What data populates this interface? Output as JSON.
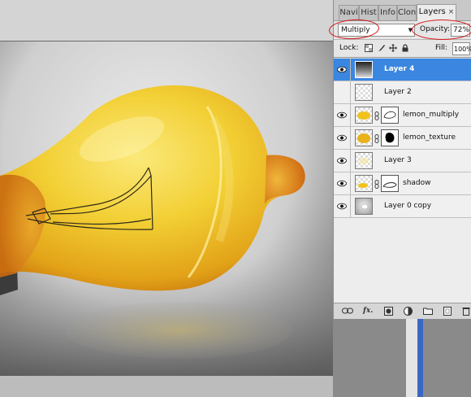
{
  "panel": {
    "tabs": [
      {
        "label": "Navi"
      },
      {
        "label": "Hist"
      },
      {
        "label": "Info"
      },
      {
        "label": "Clon"
      },
      {
        "label": "Layers",
        "active": true,
        "close": "×"
      }
    ],
    "blend_mode": "Multiply",
    "opacity_label": "Opacity:",
    "opacity_value": "72%",
    "lock_label": "Lock:",
    "fill_label": "Fill:",
    "fill_value": "100%",
    "layers": [
      {
        "name": "Layer 4",
        "selected": true,
        "visible": true,
        "thumb": "gradient",
        "mask": null
      },
      {
        "name": "Layer 2",
        "selected": false,
        "visible": false,
        "thumb": "transparent",
        "mask": null
      },
      {
        "name": "lemon_multiply",
        "selected": false,
        "visible": true,
        "thumb": "lemon",
        "mask": "outline"
      },
      {
        "name": "lemon_texture",
        "selected": false,
        "visible": true,
        "thumb": "lemon",
        "mask": "black-shape"
      },
      {
        "name": "Layer 3",
        "selected": false,
        "visible": true,
        "thumb": "transparent-light",
        "mask": null
      },
      {
        "name": "shadow",
        "selected": false,
        "visible": true,
        "thumb": "lemon-small",
        "mask": "shadow-outline"
      },
      {
        "name": "Layer 0 copy",
        "selected": false,
        "visible": true,
        "thumb": "photo",
        "mask": null
      }
    ],
    "bottom_icons": [
      "link-icon",
      "fx-icon",
      "mask-icon",
      "adjustment-icon",
      "folder-icon",
      "new-layer-icon",
      "trash-icon"
    ],
    "bottom_fx": "fx."
  },
  "annotation_color": "#d21616",
  "selection_color": "#3a86e0"
}
